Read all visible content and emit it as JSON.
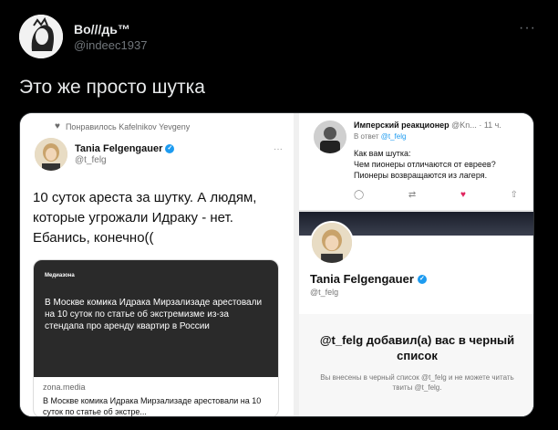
{
  "author": {
    "display_name": "Во///дь™",
    "handle": "@indeec1937"
  },
  "tweet": {
    "text": "Это же просто шутка"
  },
  "screenshot": {
    "left": {
      "liked_by": "Понравилось Kafelnikov Yevgeny",
      "name": "Tania Felgengauer",
      "handle": "@t_felg",
      "text": "10 суток ареста за шутку. А людям, которые угрожали Идраку - нет. Ебанись, конечно((",
      "card": {
        "source": "Медиазона",
        "body": "В Москве комика Идрака Мирзализаде арестовали на 10 суток по статье об экстремизме из-за стендапа про аренду квартир в России",
        "domain": "zona.media",
        "title": "В Москве комика Идрака Мирзализаде арестовали на 10 суток по статье об экстре..."
      }
    },
    "right_top": {
      "name": "Имперский реакционер",
      "meta": "@Kn... · 11 ч.",
      "reply_prefix": "В ответ",
      "reply_handle": "@t_felg",
      "line1": "Как вам шутка:",
      "line2": "Чем пионеры отличаются от евреев?",
      "line3": "Пионеры возвращаются из лагеря."
    },
    "right_bottom": {
      "name": "Tania Felgengauer",
      "handle": "@t_felg",
      "blocked_title": "@t_felg добавил(а) вас в черный список",
      "blocked_desc": "Вы внесены в черный список @t_felg и не можете читать твиты @t_felg."
    }
  }
}
